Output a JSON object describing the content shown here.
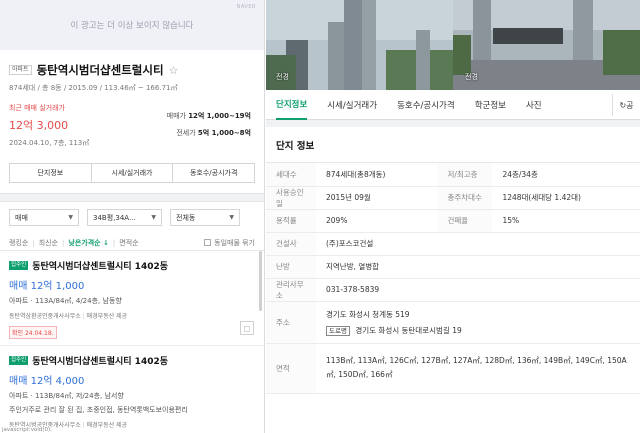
{
  "ad": {
    "text": "이 광고는 더 이상 보이지 않습니다",
    "brand": "NAVER"
  },
  "summary": {
    "type_tag": "아파트",
    "name": "동탄역시범더샵센트럴시티",
    "sub_info": "874세대 / 총 8동 / 2015.09 / 113.46㎡ ~ 166.71㎡",
    "recent_label": "최근 매매 실거래가",
    "recent_price": "12억 3,000",
    "recent_date": "2024.04.10, 7층, 113㎡",
    "sale_label": "매매가",
    "sale_value": "12억 1,000~19억",
    "rent_label": "전세가",
    "rent_value": "5억 1,000~8억"
  },
  "left_tabs": [
    "단지정보",
    "시세/실거래가",
    "동호수/공시가격"
  ],
  "filters": {
    "trade": "매매",
    "area": "34B평,34A...",
    "building": "전체동"
  },
  "sort": {
    "options": [
      "랭킹순",
      "최신순",
      "낮은가격순 ↓",
      "면적순"
    ],
    "same_listing": "동일매물 묶기"
  },
  "listings": [
    {
      "badge": "집주인",
      "name": "동탄역시범더샵센트럴시티 1402동",
      "price": "매매 12억 1,000",
      "spec": "아파트 · 113A/84㎡, 4/24층, 남동향",
      "agent": "동탄역삼환공인중개사사무소",
      "agent_source": "매경부동산 제공",
      "confirm": "확인 24.04.18."
    },
    {
      "badge": "집주인",
      "name": "동탄역시범더샵센트럴시티 1402동",
      "price": "매매 12억 4,000",
      "spec": "아파트 · 113B/84㎡, 저/24층, 남서향",
      "desc": "주인거주로 관리 잘 된 집, 초중인접, 동탄역롯백도보이용편리",
      "agent": "동탄역시범공인중개사사무소",
      "agent_source": "매경부동산 제공"
    }
  ],
  "photos": {
    "left_label": "전경",
    "right_label": "전경"
  },
  "tabs": [
    "단지정보",
    "시세/실거래가",
    "동호수/공시가격",
    "학군정보",
    "사진"
  ],
  "share_icon_label": "공",
  "detail": {
    "title": "단지 정보",
    "households_label": "세대수",
    "households": "874세대(총8개동)",
    "floors_label": "저/최고층",
    "floors": "24층/34층",
    "approval_label": "사용승인일",
    "approval": "2015년 09월",
    "parking_label": "총주차대수",
    "parking": "1248대(세대당 1.42대)",
    "far_label": "용적률",
    "far": "209%",
    "bcr_label": "건폐율",
    "bcr": "15%",
    "builder_label": "건설사",
    "builder": "(주)포스코건설",
    "heating_label": "난방",
    "heating": "지역난방, 열병합",
    "office_label": "관리사무소",
    "office": "031-378-5839",
    "address_label": "주소",
    "address": "경기도 화성시 청계동 519",
    "road_tag": "도로명",
    "road_address": "경기도 화성시 동탄대로시범길 19",
    "area_label": "면적",
    "areas": "113B㎡, 113A㎡, 126C㎡, 127B㎡, 127A㎡, 128D㎡, 136㎡, 149B㎡, 149C㎡, 150A㎡, 150D㎡, 166㎡"
  },
  "statusbar": "javascript:void(0);",
  "colors": {
    "accent_green": "#0f9f6e",
    "price_red": "#e64a4a",
    "price_blue": "#2f6fd6"
  }
}
